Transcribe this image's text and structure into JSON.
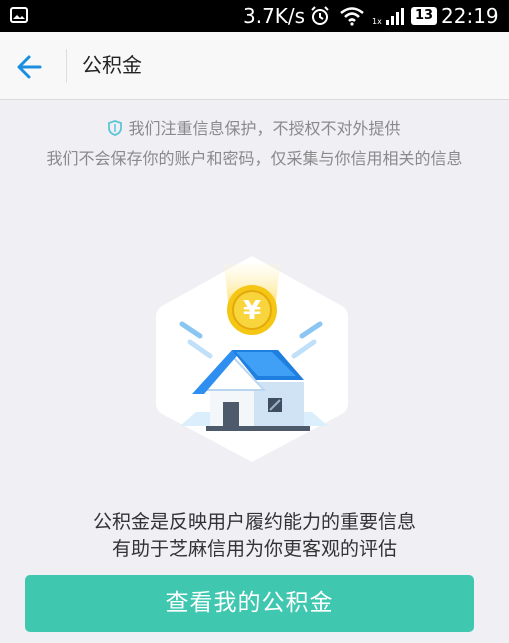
{
  "status_bar": {
    "network_speed": "3.7K/s",
    "battery_level": "13",
    "time": "22:19",
    "left_icon": "image-notification-icon",
    "alarm_icon": "alarm-icon",
    "wifi_icon": "wifi-icon",
    "signal_icon": "signal-icon"
  },
  "nav": {
    "back_icon": "back-arrow-icon",
    "title": "公积金"
  },
  "privacy_notice": {
    "icon": "shield-icon",
    "line1": "我们注重信息保护，不授权不对外提供",
    "line2": "我们不会保存你的账户和密码，仅采集与你信用相关的信息"
  },
  "illustration": {
    "name": "house-with-coin-illustration",
    "coin_symbol": "¥"
  },
  "description": {
    "line1": "公积金是反映用户履约能力的重要信息",
    "line2": "有助于芝麻信用为你更客观的评估"
  },
  "cta": {
    "label": "查看我的公积金"
  },
  "colors": {
    "accent": "#3fc7b0",
    "nav_icon": "#1a8fe0",
    "shield": "#5ec6d8",
    "roof": "#2f8ff0",
    "coin": "#f5c614"
  }
}
